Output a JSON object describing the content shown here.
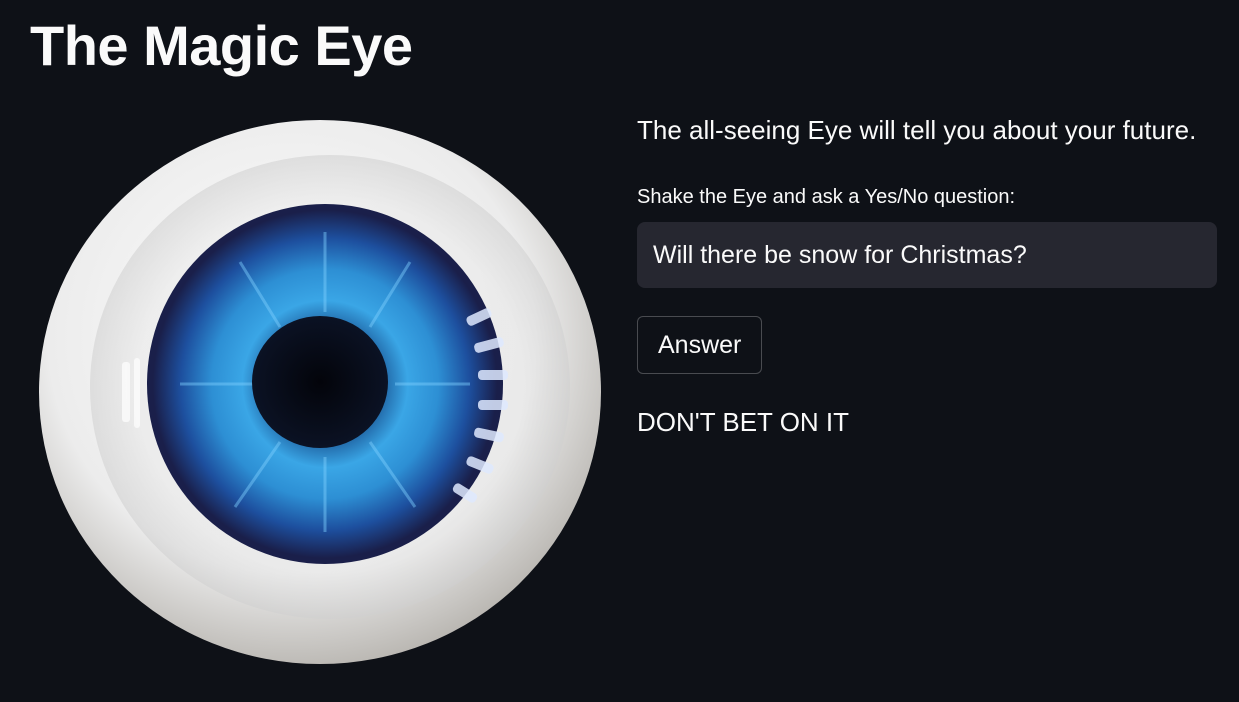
{
  "page": {
    "title": "The Magic Eye"
  },
  "main": {
    "intro_text": "The all-seeing Eye will tell you about your future.",
    "question_label": "Shake the Eye and ask a Yes/No question:",
    "question_input_value": "Will there be snow for Christmas?",
    "answer_button_label": "Answer",
    "result_text": "DON'T BET ON IT"
  },
  "image": {
    "icon": "eye-image",
    "description_colors": {
      "sclera": "#f2f2f2",
      "iris": "#2a8fd6",
      "pupil": "#0b0d1a"
    }
  },
  "theme": {
    "background": "#0e1117",
    "text": "#fafafa",
    "input_background": "#262730"
  }
}
